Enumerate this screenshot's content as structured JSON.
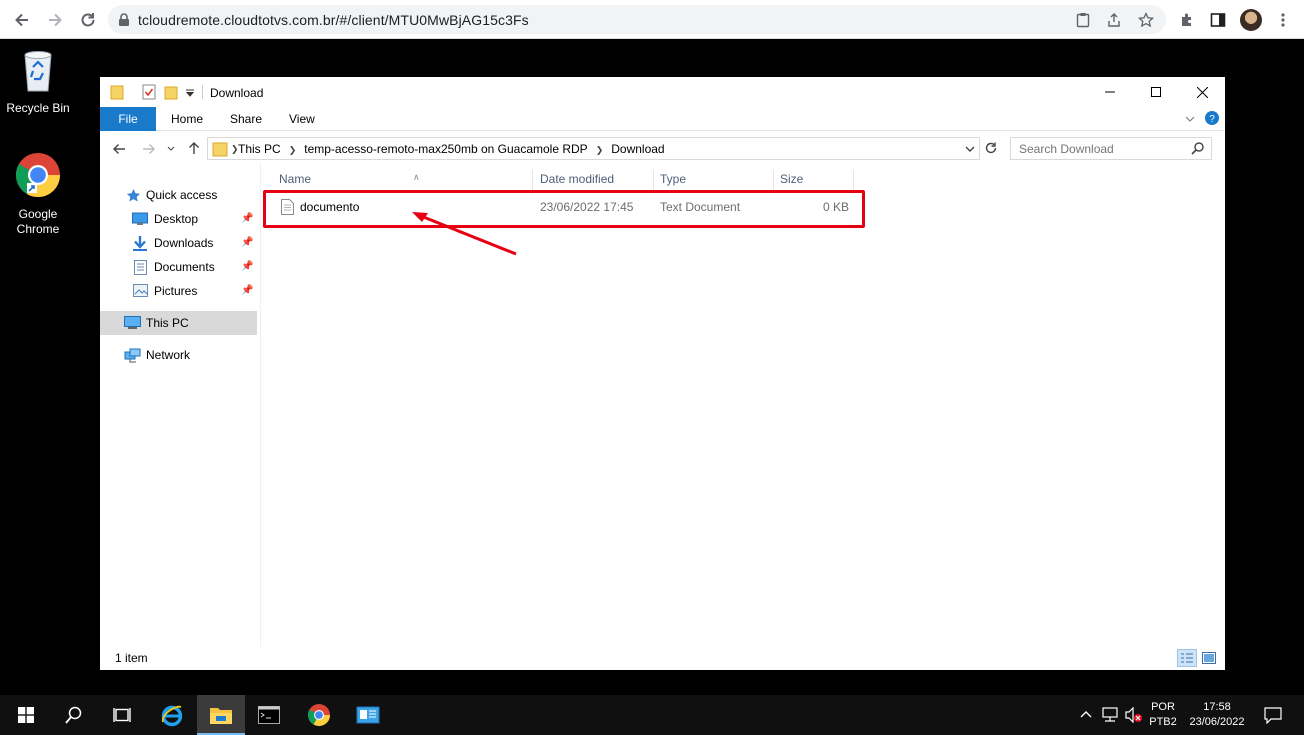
{
  "browser": {
    "url": "tcloudremote.cloudtotvs.com.br/#/client/MTU0MwBjAG15c3Fs"
  },
  "desktop": {
    "icons": [
      {
        "label": "Recycle Bin"
      },
      {
        "label": "Google Chrome"
      }
    ]
  },
  "explorer": {
    "title": "Download",
    "ribbon": {
      "file": "File",
      "home": "Home",
      "share": "Share",
      "view": "View"
    },
    "breadcrumb": [
      "This PC",
      "temp-acesso-remoto-max250mb on Guacamole RDP",
      "Download"
    ],
    "search_placeholder": "Search Download",
    "nav": {
      "quick_access": "Quick access",
      "desktop": "Desktop",
      "downloads": "Downloads",
      "documents": "Documents",
      "pictures": "Pictures",
      "this_pc": "This PC",
      "network": "Network"
    },
    "columns": {
      "name": "Name",
      "date": "Date modified",
      "type": "Type",
      "size": "Size"
    },
    "files": [
      {
        "name": "documento",
        "date": "23/06/2022 17:45",
        "type": "Text Document",
        "size": "0 KB"
      }
    ],
    "status": "1 item"
  },
  "taskbar": {
    "lang_top": "POR",
    "lang_bottom": "PTB2",
    "time": "17:58",
    "date": "23/06/2022"
  },
  "colors": {
    "accent": "#1979ca",
    "highlight": "#e60012"
  }
}
